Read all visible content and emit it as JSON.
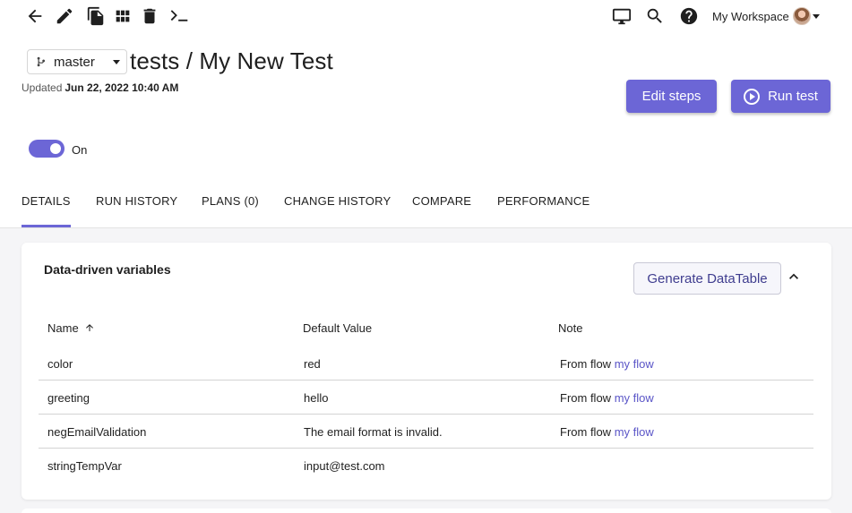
{
  "toolbar": {
    "icons": [
      "back-arrow-icon",
      "edit-pencil-icon",
      "copy-icon",
      "grid-icon",
      "delete-icon",
      "terminal-icon"
    ],
    "right_icons": [
      "monitor-icon",
      "search-icon",
      "help-icon"
    ],
    "workspace_label": "My Workspace"
  },
  "header": {
    "branch": "master",
    "title": "tests / My New Test",
    "updated_label": "Updated",
    "updated_value": "Jun 22, 2022 10:40 AM",
    "edit_button": "Edit steps",
    "run_button": "Run test",
    "toggle_label": "On",
    "toggle_state": "on"
  },
  "tabs": [
    {
      "label": "DETAILS",
      "active": true
    },
    {
      "label": "RUN HISTORY",
      "active": false
    },
    {
      "label": "PLANS (0)",
      "active": false
    },
    {
      "label": "CHANGE HISTORY",
      "active": false
    },
    {
      "label": "COMPARE",
      "active": false
    },
    {
      "label": "PERFORMANCE",
      "active": false
    }
  ],
  "variables": {
    "title": "Data-driven variables",
    "generate_button": "Generate DataTable",
    "columns": [
      "Name",
      "Default Value",
      "Note"
    ],
    "sort": "ascending",
    "rows": [
      {
        "name": "color",
        "value": "red",
        "note_prefix": "From flow",
        "note_link": "my flow"
      },
      {
        "name": "greeting",
        "value": "hello",
        "note_prefix": "From flow",
        "note_link": "my flow"
      },
      {
        "name": "negEmailValidation",
        "value": "The email format is invalid.",
        "note_prefix": "From flow",
        "note_link": "my flow"
      },
      {
        "name": "stringTempVar",
        "value": "input@test.com",
        "note_prefix": "",
        "note_link": ""
      }
    ]
  },
  "colors": {
    "accent": "#6c66d6",
    "link": "#5a55c7",
    "background": "#f5f5f7"
  }
}
